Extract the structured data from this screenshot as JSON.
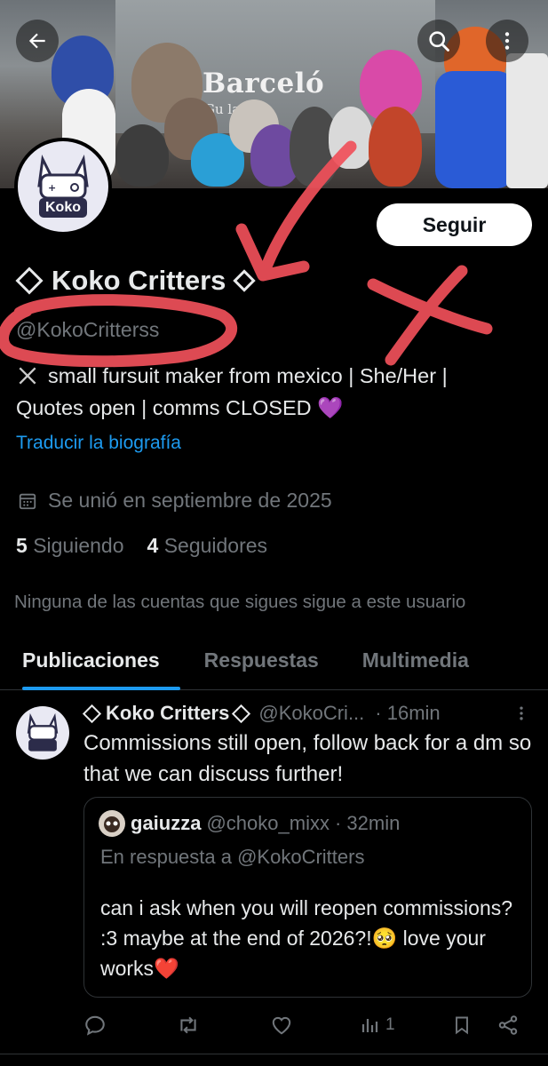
{
  "profile": {
    "name": "Koko Critters",
    "handle": "@KokoCritterss",
    "bio_line1": "small fursuit maker from mexico | She/Her |",
    "bio_line2": "Quotes open | comms CLOSED 💜",
    "translate": "Traducir la biografía",
    "joined": "Se unió en septiembre de 2025",
    "following_count": "5",
    "following_label": "Siguiendo",
    "followers_count": "4",
    "followers_label": "Seguidores",
    "no_mutuals": "Ninguna de las cuentas que sigues sigue a este usuario",
    "follow_button": "Seguir",
    "avatar_text": "Koko"
  },
  "banner": {
    "sign_line1": "Barceló",
    "sign_line2": "Gu    lajar"
  },
  "tabs": [
    {
      "label": "Publicaciones",
      "active": true
    },
    {
      "label": "Respuestas",
      "active": false
    },
    {
      "label": "Multimedia",
      "active": false
    }
  ],
  "post": {
    "name": "Koko Critters",
    "handle": "@KokoCri...",
    "time": "· 16min",
    "text": "Commissions still open, follow back for a dm so that we can discuss further!",
    "quote": {
      "name": "gaiuzza",
      "handle": "@choko_mixx",
      "time": "· 32min",
      "reply_to": "En respuesta a @KokoCritters",
      "text": "can i ask when you will reopen commissions? :3 maybe at the end of 2026?!🥺 love your works❤️"
    },
    "views": "1"
  },
  "colors": {
    "accent": "#1d9bf0",
    "annotation": "#f0505a",
    "muted": "#71767b"
  },
  "icons": [
    "back-arrow-icon",
    "search-icon",
    "more-vertical-icon",
    "calendar-icon",
    "reply-icon",
    "retweet-icon",
    "like-icon",
    "views-icon",
    "bookmark-icon",
    "share-icon"
  ]
}
